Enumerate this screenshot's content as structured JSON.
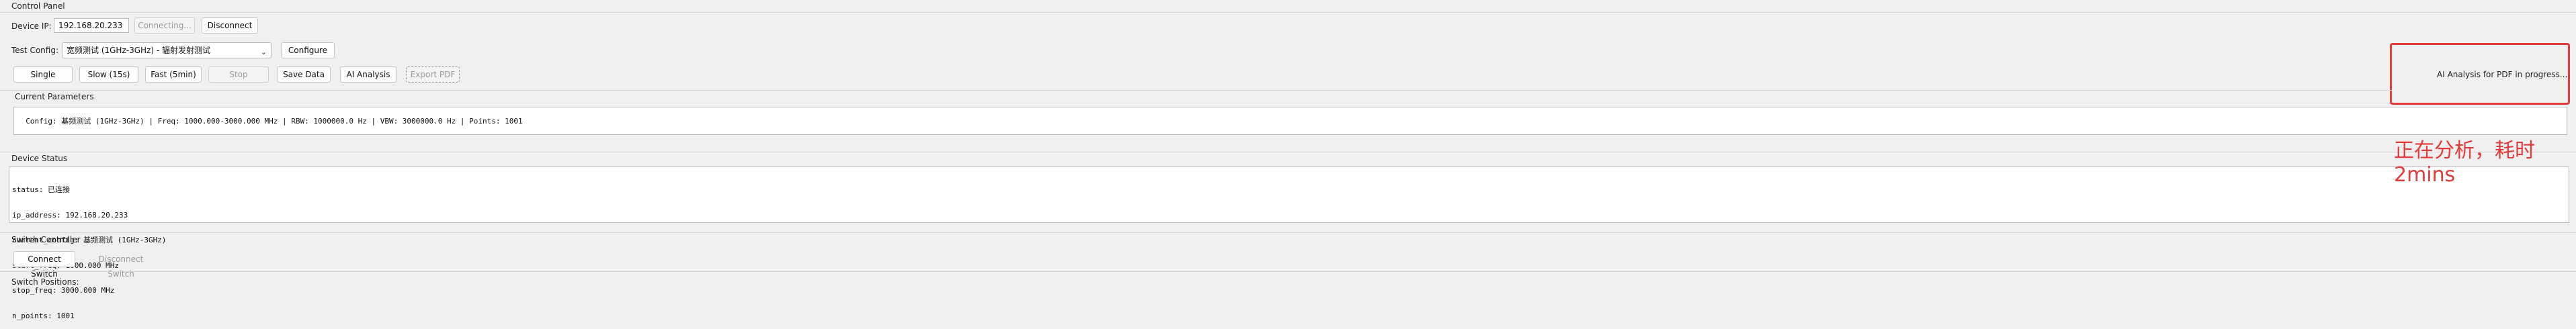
{
  "window": {
    "title": "Control Panel"
  },
  "device": {
    "ip_label": "Device IP:",
    "ip_value": "192.168.20.233",
    "connect_button": "Connecting...",
    "disconnect_button": "Disconnect"
  },
  "test_config": {
    "label": "Test Config:",
    "selected": "宽频测试 (1GHz-3GHz) - 辐射发射测试",
    "configure_button": "Configure"
  },
  "actions": {
    "single": "Single",
    "slow": "Slow (15s)",
    "fast": "Fast (5min)",
    "stop": "Stop",
    "save": "Save Data",
    "ai": "AI Analysis",
    "export": "Export PDF"
  },
  "ai_status": "AI Analysis for PDF in progress...",
  "current_parameters": {
    "title": "Current Parameters",
    "text": "Config: 基频测试 (1GHz-3GHz) | Freq: 1000.000-3000.000 MHz | RBW: 1000000.0 Hz | VBW: 3000000.0 Hz | Points: 1001"
  },
  "device_status": {
    "title": "Device Status",
    "lines": [
      "status: 已连接",
      "ip_address: 192.168.20.233",
      "current_config: 基频测试 (1GHz-3GHz)",
      "start_freq: 1000.000 MHz",
      "stop_freq: 3000.000 MHz",
      "n_points: 1001"
    ]
  },
  "switch_controller": {
    "title": "Switch Controller",
    "connect_button": "Connect Switch",
    "disconnect_button": "Disconnect Switch",
    "positions_label": "Switch Positions:"
  },
  "annotation": {
    "line1": "正在分析，耗时",
    "line2": "2mins"
  },
  "colors": {
    "annotation_red": "#e23b3b"
  }
}
